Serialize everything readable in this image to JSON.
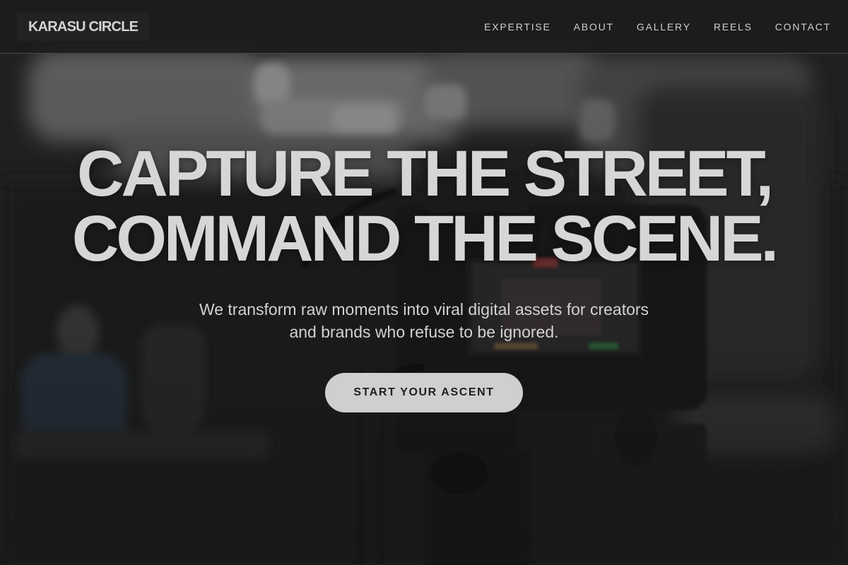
{
  "header": {
    "logo": "KARASU CIRCLE",
    "nav": [
      {
        "label": "EXPERTISE"
      },
      {
        "label": "ABOUT"
      },
      {
        "label": "GALLERY"
      },
      {
        "label": "REELS"
      },
      {
        "label": "CONTACT"
      }
    ]
  },
  "hero": {
    "title_lines": [
      "CAPTURE THE STREET,",
      "COMMAND THE SCENE."
    ],
    "subtitle_lines": [
      "We transform raw moments into viral digital assets for creators",
      "and brands who refuse to be ignored."
    ],
    "cta_label": "START YOUR ASCENT"
  },
  "colors": {
    "header_bg": "#1c1c1c",
    "text_primary": "#d6d6d6",
    "cta_bg": "#cfcfcf",
    "cta_text": "#1e1e1e"
  }
}
